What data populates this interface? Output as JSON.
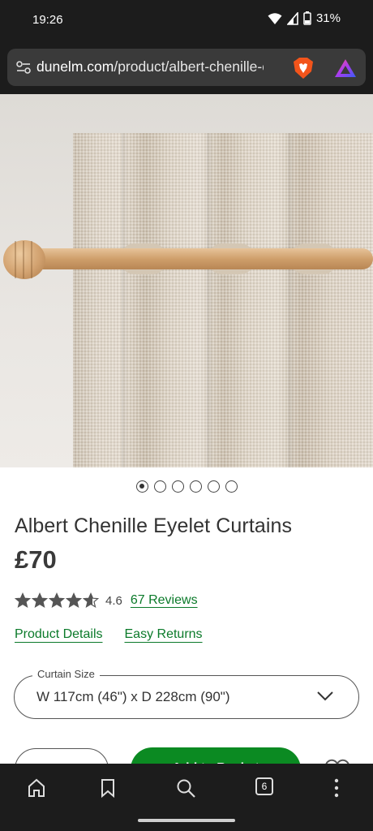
{
  "status_bar": {
    "time": "19:26",
    "battery": "31%",
    "icons": [
      "wifi-icon",
      "signal-icon",
      "battery-icon"
    ]
  },
  "browser": {
    "url_domain": "dunelm.com",
    "url_path": "/product/albert-chenille-ey",
    "icons": [
      "site-settings-icon",
      "brave-shields-icon",
      "brave-rewards-icon"
    ]
  },
  "gallery": {
    "image_alt_icon": "curtain-product-image",
    "dot_count": 6,
    "active_index": 0
  },
  "product": {
    "title": "Albert Chenille Eyelet Curtains",
    "price": "£70",
    "rating_value": "4.6",
    "rating_stars": 4.6,
    "reviews_link": "67 Reviews",
    "details_link": "Product Details",
    "returns_link": "Easy Returns"
  },
  "size_select": {
    "legend": "Curtain Size",
    "value": "W 117cm (46\") x D 228cm (90\")"
  },
  "actions": {
    "add_to_basket": "Add to Basket"
  },
  "bottom_nav": {
    "tabs_count": "6",
    "icons": [
      "home-icon",
      "bookmark-icon",
      "search-icon",
      "tabs-icon",
      "more-menu-icon"
    ]
  },
  "colors": {
    "accent_green": "#0b7a2a",
    "button_green": "#0b8a22",
    "chrome_dark": "#1c1c1c"
  }
}
